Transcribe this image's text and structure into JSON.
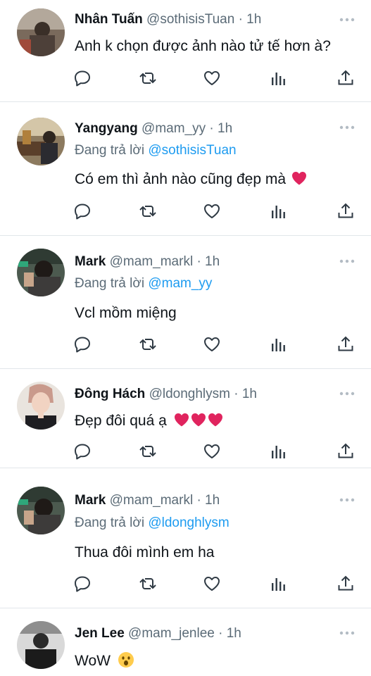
{
  "tweets": [
    {
      "name": "Nhân Tuấn",
      "handle": "@sothisisTuan",
      "time": "· 1h",
      "reply_prefix": "",
      "reply_to": "",
      "text": "Anh k chọn được ảnh nào tử tế hơn à?",
      "emoji": ""
    },
    {
      "name": "Yangyang",
      "handle": "@mam_yy",
      "time": "· 1h",
      "reply_prefix": "Đang trả lời",
      "reply_to": "@sothisisTuan",
      "text": "Có em thì ảnh nào cũng đẹp mà",
      "emoji": "red-heart"
    },
    {
      "name": "Mark",
      "handle": "@mam_markl",
      "time": "· 1h",
      "reply_prefix": "Đang trả lời",
      "reply_to": "@mam_yy",
      "text": "Vcl mồm miệng",
      "emoji": ""
    },
    {
      "name": "Đông Hách",
      "handle": "@ldonghlysm",
      "time": "· 1h",
      "reply_prefix": "",
      "reply_to": "",
      "text": "Đẹp đôi quá ạ",
      "emoji": "red-heart x3"
    },
    {
      "name": "Mark",
      "handle": "@mam_markl",
      "time": "· 1h",
      "reply_prefix": "Đang trả lời",
      "reply_to": "@ldonghlysm",
      "text": "Thua đôi mình em ha",
      "emoji": ""
    },
    {
      "name": "Jen Lee",
      "handle": "@mam_jenlee",
      "time": "· 1h",
      "reply_prefix": "",
      "reply_to": "",
      "text": "WoW",
      "emoji": "astonished-face"
    }
  ],
  "icons": {
    "reply": "speech-bubble-icon",
    "retweet": "retweet-icon",
    "like": "heart-outline-icon",
    "stats": "bar-chart-icon",
    "share": "share-upload-icon",
    "more": "more-dots-icon"
  },
  "colors": {
    "text": "#0f1419",
    "secondary": "#5b6b77",
    "mention": "#1d9bf0",
    "divider": "#e1e6ea",
    "emoji_heart": "#e0245e"
  }
}
